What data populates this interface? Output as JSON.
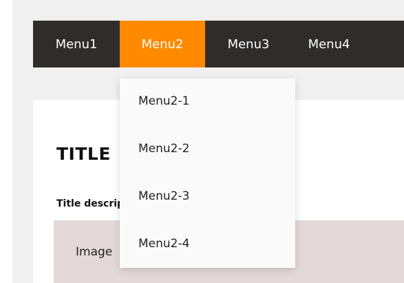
{
  "nav": {
    "items": [
      {
        "label": "Menu1",
        "active": false
      },
      {
        "label": "Menu2",
        "active": true
      },
      {
        "label": "Menu3",
        "active": false
      },
      {
        "label": "Menu4",
        "active": false
      }
    ]
  },
  "dropdown": {
    "items": [
      "Menu2-1",
      "Menu2-2",
      "Menu2-3",
      "Menu2-4"
    ]
  },
  "content": {
    "title": "TITLE",
    "description": "Title description",
    "image_label": "Image"
  },
  "colors": {
    "nav_background": "#2f2d2b",
    "active_accent": "#ff8a00",
    "image_background": "#e2d8d9"
  }
}
